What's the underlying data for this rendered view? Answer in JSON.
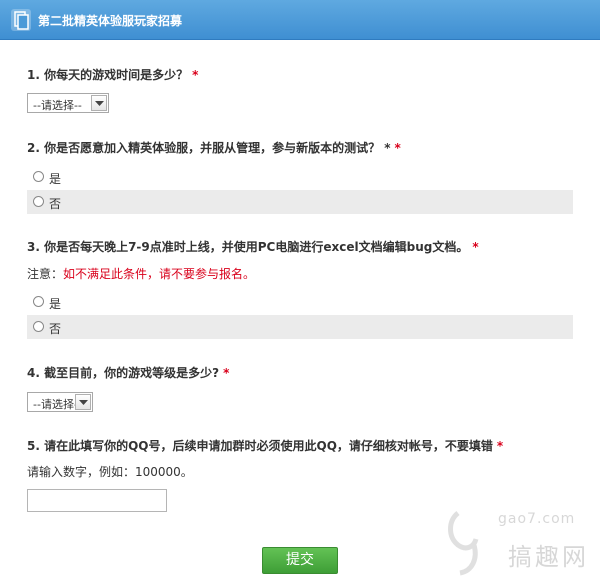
{
  "header": {
    "title": "第二批精英体验服玩家招募"
  },
  "q1": {
    "title": "1. 你每天的游戏时间是多少？",
    "required": "*",
    "select_value": "--请选择--"
  },
  "q2": {
    "title": "2. 你是否愿意加入精英体验服，并服从管理，参与新版本的测试？ *",
    "required": "*",
    "options": [
      "是",
      "否"
    ]
  },
  "q3": {
    "title": "3. 你是否每天晚上7-9点准时上线，并使用PC电脑进行excel文档编辑bug文档。",
    "required": "*",
    "note_label": "注意：",
    "note_text": "如不满足此条件，请不要参与报名。",
    "options": [
      "是",
      "否"
    ]
  },
  "q4": {
    "title": "4. 截至目前，你的游戏等级是多少?",
    "required": "*",
    "select_value": "--请选择--"
  },
  "q5": {
    "title": "5. 请在此填写你的QQ号，后续申请加群时必须使用此QQ，请仔细核对帐号，不要填错",
    "required": "*",
    "hint": "请输入数字，例如：100000。",
    "input_value": ""
  },
  "submit_label": "提交",
  "watermark": {
    "url": "gao7.com",
    "name": "搞趣网"
  },
  "colors": {
    "header": "#4a9ad8",
    "required": "#d9001b",
    "submit": "#4caf3f",
    "shaded_row": "#ebebeb"
  }
}
